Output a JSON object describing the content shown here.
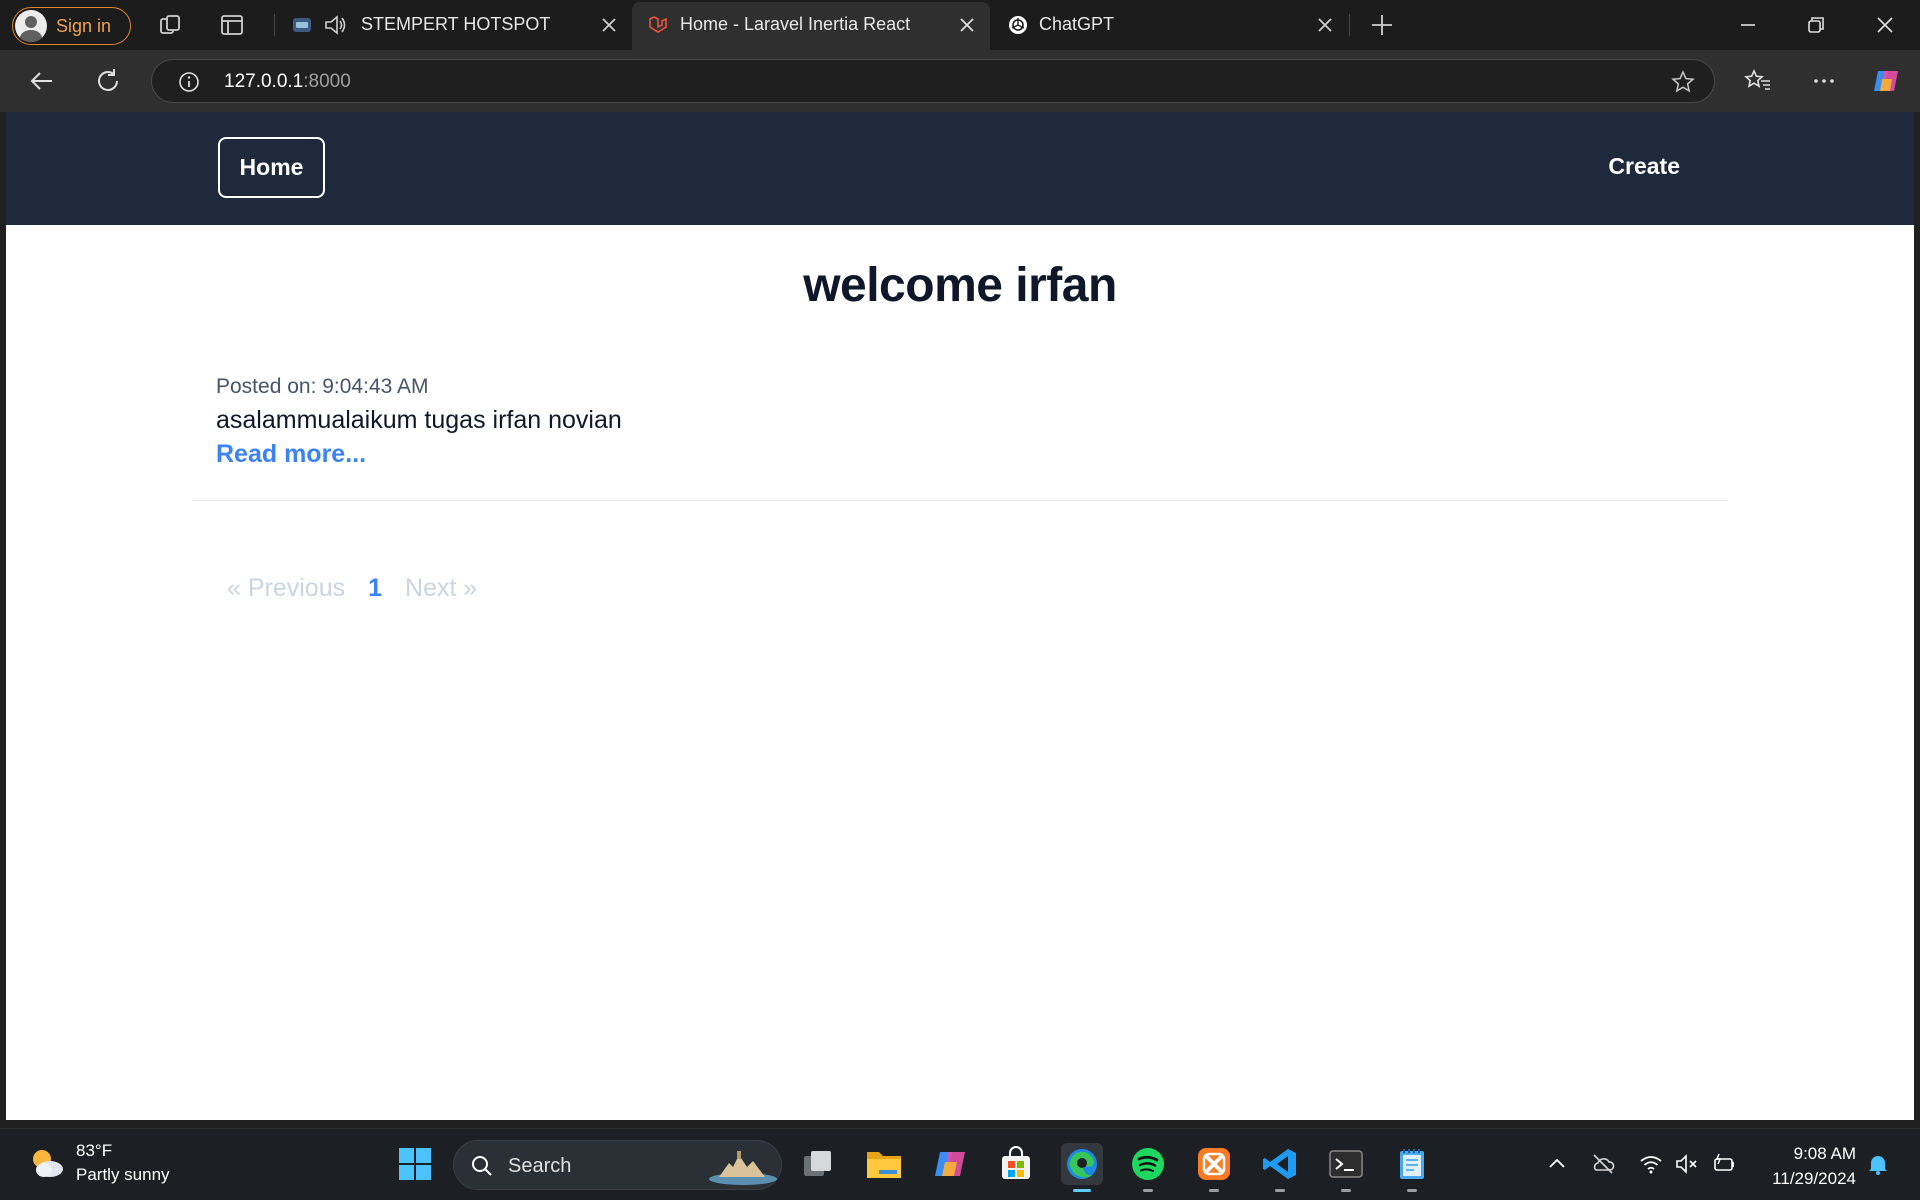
{
  "browser": {
    "signin_label": "Sign in",
    "tabs": [
      {
        "title": "STEMPERT HOTSPOT",
        "icon": "wifi-portal-icon",
        "audio": true
      },
      {
        "title": "Home - Laravel Inertia React",
        "icon": "laravel-icon",
        "active": true
      },
      {
        "title": "ChatGPT",
        "icon": "chatgpt-icon"
      }
    ],
    "address": {
      "host": "127.0.0.1",
      "port": ":8000"
    }
  },
  "site": {
    "nav": {
      "home_label": "Home",
      "create_label": "Create"
    },
    "heading": "welcome irfan",
    "posts": [
      {
        "meta": "Posted on: 9:04:43 AM",
        "body": "asalammualaikum tugas irfan novian",
        "read_more": "Read more..."
      }
    ],
    "pagination": {
      "prev": "« Previous",
      "current": "1",
      "next": "Next »"
    }
  },
  "taskbar": {
    "weather": {
      "temp": "83°F",
      "desc": "Partly sunny"
    },
    "search_label": "Search",
    "apps": [
      "task-view-icon",
      "file-explorer-icon",
      "copilot-icon",
      "microsoft-store-icon",
      "edge-icon",
      "spotify-icon",
      "xampp-icon",
      "vscode-icon",
      "terminal-icon",
      "notepad-icon"
    ],
    "clock": {
      "time": "9:08 AM",
      "date": "11/29/2024"
    }
  },
  "colors": {
    "nav_bg": "#1e293b",
    "link_blue": "#3b82f6",
    "disabled_gray": "#cbd5e1",
    "signin_orange": "#f3a155"
  }
}
